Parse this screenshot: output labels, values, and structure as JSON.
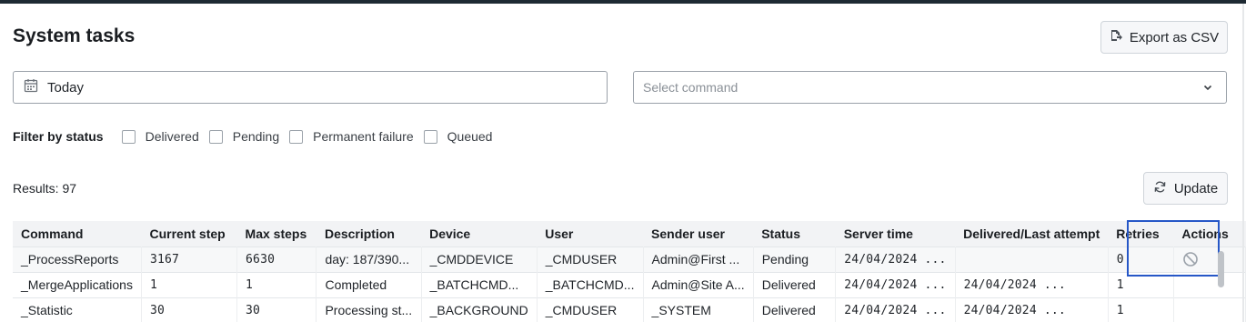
{
  "page": {
    "title": "System tasks"
  },
  "toolbar": {
    "export_label": "Export as CSV",
    "update_label": "Update"
  },
  "filters": {
    "date_value": "Today",
    "command_placeholder": "Select command",
    "status_label": "Filter by status",
    "statuses": [
      "Delivered",
      "Pending",
      "Permanent failure",
      "Queued"
    ]
  },
  "results": {
    "text": "Results: 97"
  },
  "table": {
    "columns": [
      "Command",
      "Current step",
      "Max steps",
      "Description",
      "Device",
      "User",
      "Sender user",
      "Status",
      "Server time",
      "Delivered/Last attempt",
      "Retries",
      "Actions"
    ],
    "rows": [
      [
        "_ProcessReports",
        "3167",
        "6630",
        "day: 187/390...",
        "_CMDDEVICE",
        "_CMDUSER",
        "Admin@First ...",
        "Pending",
        "24/04/2024 ...",
        "",
        "0",
        ""
      ],
      [
        "_MergeApplications",
        "1",
        "1",
        "Completed",
        "_BATCHCMD...",
        "_BATCHCMD...",
        "Admin@Site A...",
        "Delivered",
        "24/04/2024 ...",
        "24/04/2024 ...",
        "1",
        ""
      ],
      [
        "_Statistic",
        "30",
        "30",
        "Processing st...",
        "_BACKGROUND",
        "_CMDUSER",
        "_SYSTEM",
        "Delivered",
        "24/04/2024 ...",
        "24/04/2024 ...",
        "1",
        ""
      ]
    ]
  },
  "icons": {
    "export": "export-file-icon",
    "calendar": "calendar-icon",
    "chevron": "chevron-down-icon",
    "refresh": "refresh-icon",
    "cancel": "cancel-icon"
  },
  "colors": {
    "accent_outline": "#2657c7",
    "header_bg": "#f2f3f5",
    "top_bar": "#1e2a33"
  }
}
